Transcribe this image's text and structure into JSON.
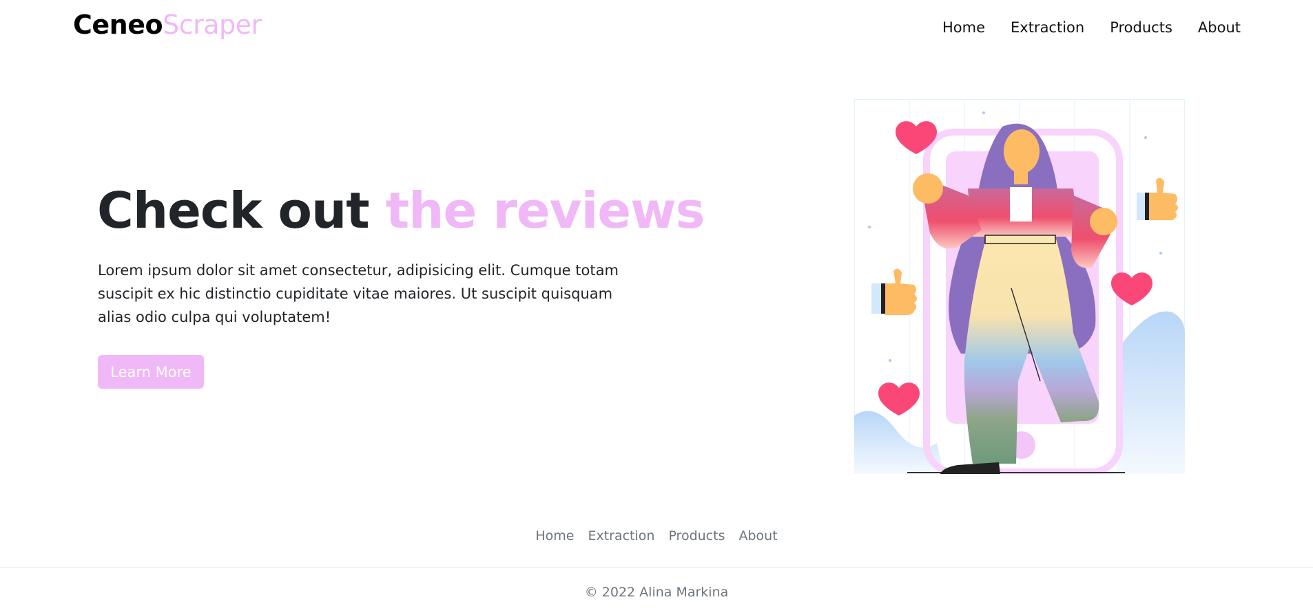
{
  "colors": {
    "accent": "#f0b8f7",
    "text_dark": "#212529",
    "muted": "#6c757d"
  },
  "brand": {
    "part1": "Ceneo",
    "part2": "Scraper"
  },
  "nav": {
    "items": [
      {
        "label": "Home"
      },
      {
        "label": "Extraction"
      },
      {
        "label": "Products"
      },
      {
        "label": "About"
      }
    ]
  },
  "hero": {
    "title_plain": "Check out ",
    "title_accent": "the reviews",
    "description": "Lorem ipsum dolor sit amet consectetur, adipisicing elit. Cumque totam suscipit ex hic distinctio cupiditate vitae maiores. Ut suscipit quisquam alias odio culpa qui voluptatem!",
    "button_label": "Learn More"
  },
  "illustration": {
    "icons": [
      "heart-icon",
      "thumbs-up-icon",
      "smartphone-icon"
    ]
  },
  "footer": {
    "links": [
      {
        "label": "Home"
      },
      {
        "label": "Extraction"
      },
      {
        "label": "Products"
      },
      {
        "label": "About"
      }
    ],
    "copyright": "© 2022 Alina Markina"
  }
}
